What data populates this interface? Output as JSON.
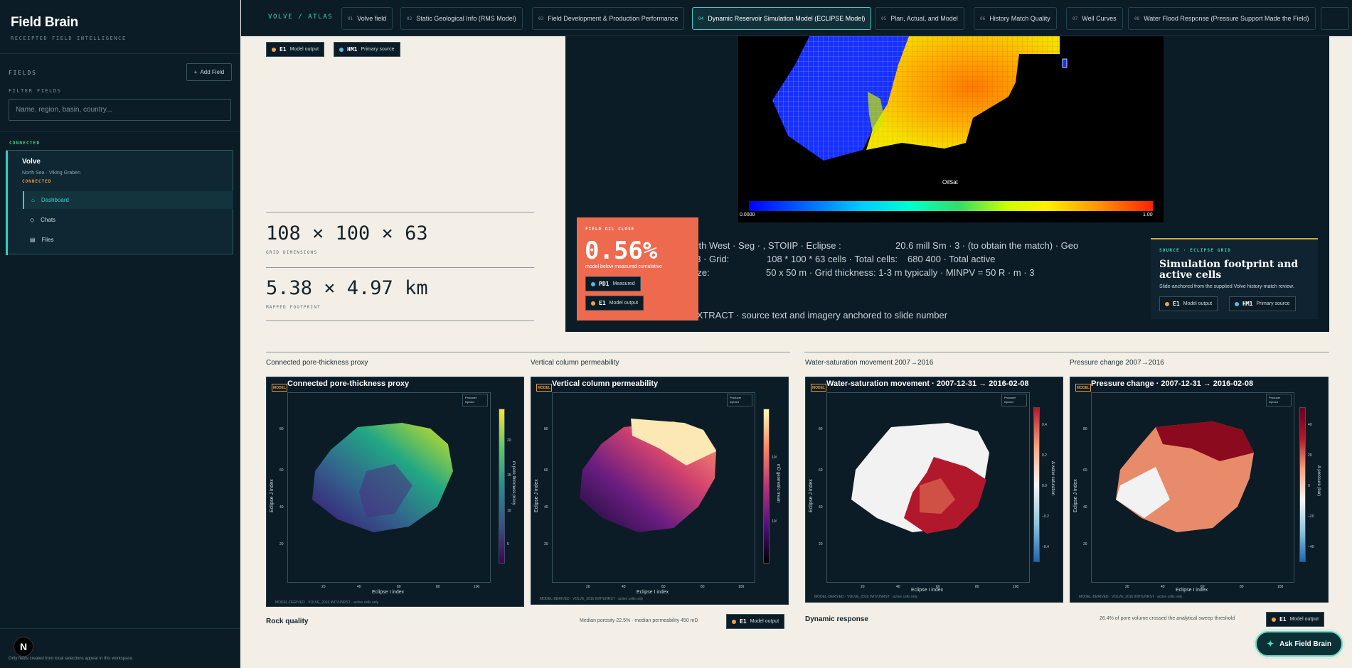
{
  "sidebar": {
    "brand": "Field Brain",
    "tagline": "RECEIPTED FIELD INTELLIGENCE",
    "fields_label": "FIELDS",
    "add_field_label": "Add Field",
    "filter_label": "FILTER FIELDS",
    "filter_placeholder": "Name, region, basin, country...",
    "connected_label": "CONNECTED",
    "field": {
      "name": "Volve",
      "region": "North Sea · Viking Graben",
      "status": "CONNECTED"
    },
    "nav": [
      {
        "icon": "⌂",
        "label": "Dashboard",
        "active": true
      },
      {
        "icon": "◇",
        "label": "Chats",
        "active": false
      },
      {
        "icon": "▤",
        "label": "Files",
        "active": false
      }
    ],
    "footer_text": "Only fields created from local selections appear in this workspace.",
    "n_badge": "N"
  },
  "topnav": {
    "breadcrumb": "VOLVE / ATLAS",
    "tabs": [
      {
        "num": "",
        "label": "Volve field"
      },
      {
        "num": "02",
        "label": "Static Geological Info (RMS Model)"
      },
      {
        "num": "03",
        "label": "Field Development & Production Performance"
      },
      {
        "num": "04",
        "label": "Dynamic Reservoir Simulation Model (ECLIPSE Model)"
      },
      {
        "num": "05",
        "label": "Plan, Actual, and Model"
      },
      {
        "num": "06",
        "label": "History Match Quality"
      },
      {
        "num": "07",
        "label": "Well Curves"
      },
      {
        "num": "08",
        "label": "Water Flood Response (Pressure Support Made the Field)"
      }
    ]
  },
  "chips": {
    "e1_code": "E1",
    "e1_label": "Model output",
    "hm1_code": "HM1",
    "hm1_label": "Primary source",
    "pd1_code": "PD1",
    "pd1_label": "Measured"
  },
  "stats": [
    {
      "value": "108 × 100 × 63",
      "label": "GRID DIMENSIONS"
    },
    {
      "value": "5.38 × 4.97 km",
      "label": "MAPPED FOOTPRINT"
    }
  ],
  "panel": {
    "colorbar_title": "OilSat",
    "colorbar_min": "0.0000",
    "colorbar_max": "1.00",
    "lines": [
      "orth West · Seg · , STOIIP · Eclipse :",
      "20.6 mill Sm · 3 · (to obtain the match) · Geo",
      "n3 · Grid:",
      "108 * 100 * 63 cells · Total cells:",
      "680 400 · Total active",
      "size:",
      "50 x 50 m · Grid thickness: 1-3 m typically · MINPV = 50 R · m · 3",
      "EXTRACT · source text and imagery anchored to slide number"
    ],
    "callout": {
      "label": "FIELD OIL CLOSE",
      "value": "0.56%",
      "sub": "model below measured cumulative"
    },
    "source_card": {
      "label": "SOURCE · ECLIPSE GRID",
      "title": "Simulation footprint and active cells",
      "desc": "Slide-anchored from the supplied Volve history-match review."
    }
  },
  "plots": [
    {
      "caption": "Connected pore-thickness proxy",
      "title": "Connected pore-thickness proxy",
      "xlabel": "Eclipse I index",
      "ylabel": "Eclipse J index",
      "cblabel": "m pore thickness proxy",
      "xticks": [
        "20",
        "40",
        "60",
        "80",
        "100"
      ],
      "yticks": [
        "80",
        "60",
        "40",
        "20"
      ],
      "cbticks": [
        "20",
        "15",
        "10",
        "5"
      ],
      "legend": [
        "Producer",
        "Injector"
      ],
      "foot": "MODEL-DERIVED · VOLVE_2016 INIT/UNRST · active cells only",
      "tag": "MODEL"
    },
    {
      "caption": "Vertical column permeability",
      "title": "Vertical column permeability",
      "xlabel": "Eclipse I index",
      "ylabel": "Eclipse J index",
      "cblabel": "mD geometric mean",
      "xticks": [
        "20",
        "40",
        "60",
        "80",
        "100"
      ],
      "yticks": [
        "80",
        "60",
        "40",
        "20"
      ],
      "cbticks": [
        "10³",
        "10²"
      ],
      "legend": [
        "Producer",
        "Injector"
      ],
      "foot": "MODEL-DERIVED · VOLVE_2016 INIT/UNRST · active cells only",
      "tag": "MODEL"
    },
    {
      "caption": "Water-saturation movement 2007→2016",
      "title": "Water-saturation movement · 2007-12-31 → 2016-02-08",
      "xlabel": "Eclipse I index",
      "ylabel": "Eclipse J index",
      "cblabel": "Δ water saturation",
      "xticks": [
        "20",
        "40",
        "60",
        "80",
        "100"
      ],
      "yticks": [
        "80",
        "60",
        "40",
        "20"
      ],
      "cbticks": [
        "0.4",
        "0.2",
        "0.0",
        "−0.2",
        "−0.4"
      ],
      "legend": [
        "Producer",
        "Injector"
      ],
      "foot": "MODEL-DERIVED · VOLVE_2016 INIT/UNRST · active cells only",
      "tag": "MODEL"
    },
    {
      "caption": "Pressure change 2007→2016",
      "title": "Pressure change · 2007-12-31 → 2016-02-08",
      "xlabel": "Eclipse I index",
      "ylabel": "Eclipse J index",
      "cblabel": "Δ pressure (bar)",
      "xticks": [
        "20",
        "40",
        "60",
        "80",
        "100"
      ],
      "yticks": [
        "80",
        "60",
        "40",
        "20"
      ],
      "cbticks": [
        "40",
        "20",
        "0",
        "−20",
        "−40"
      ],
      "legend": [
        "Producer",
        "Injector"
      ],
      "foot": "MODEL-DERIVED · VOLVE_2016 INIT/UNRST · active cells only",
      "tag": "MODEL"
    }
  ],
  "sections": {
    "rock_title": "Rock quality",
    "rock_note": "Median porosity 22.5% · median permeability 450 mD",
    "dynamic_title": "Dynamic response",
    "dynamic_note": "26.4% of pore volume crossed the analytical sweep threshold"
  },
  "ask_label": "Ask Field Brain",
  "colors": {
    "teal": "#3fd0c1",
    "orange": "#ee6a4e",
    "navy": "#0b1c26",
    "cream": "#f3efe6"
  }
}
